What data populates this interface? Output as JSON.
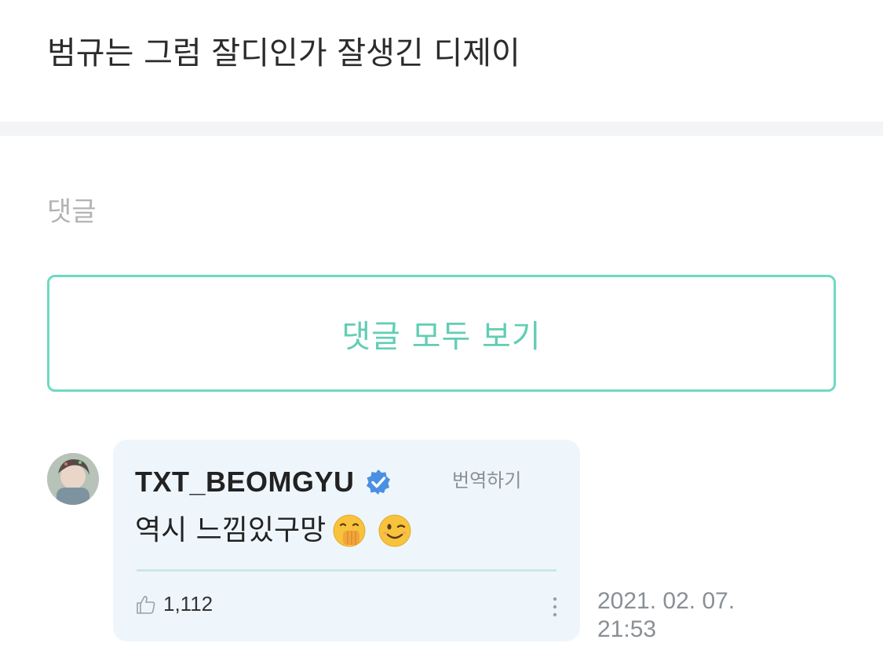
{
  "post": {
    "text": "범규는 그럼 잘디인가 잘생긴 디제이"
  },
  "comments": {
    "heading": "댓글",
    "view_all_label": "댓글 모두 보기",
    "items": [
      {
        "author": "TXT_BEOMGYU",
        "verified": true,
        "translate_label": "번역하기",
        "body": "역시 느낌있구망",
        "emojis": [
          "face-with-hand-over-mouth-icon",
          "winking-face-icon"
        ],
        "likes": "1,112",
        "timestamp_date": "2021. 02. 07.",
        "timestamp_time": "21:53"
      }
    ]
  },
  "colors": {
    "accent": "#62cdb4",
    "accent_border": "#6fd9c3",
    "bubble_bg": "#eef6fc",
    "verified_blue": "#4a90e2",
    "muted_text": "#8a8f96"
  }
}
